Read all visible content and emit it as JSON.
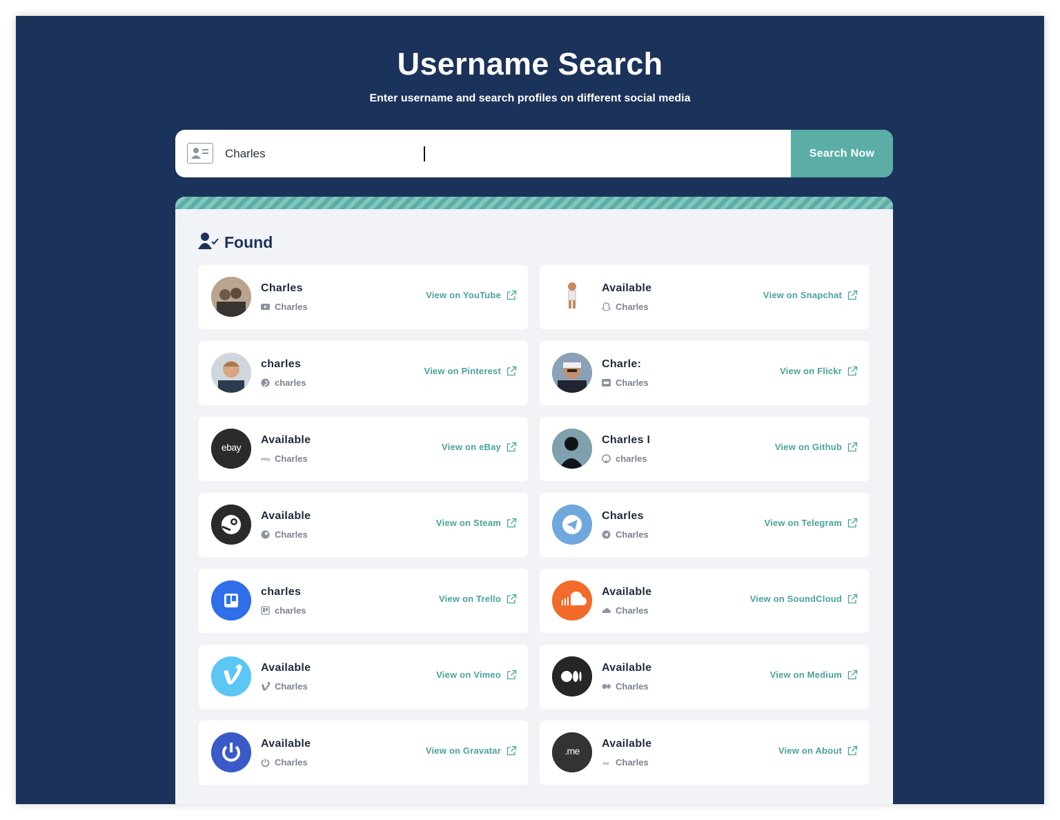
{
  "header": {
    "title": "Username Search",
    "subtitle": "Enter username and search profiles on different social media"
  },
  "search": {
    "value": "Charles",
    "placeholder": "",
    "button_label": "Search Now"
  },
  "results": {
    "heading": "Found",
    "cards": [
      {
        "name": "Charles ",
        "sub": "Charles",
        "link": "View on YouTube",
        "icon": "youtube-icon"
      },
      {
        "name": "Available",
        "sub": "Charles",
        "link": "View on Snapchat",
        "icon": "snapchat-icon"
      },
      {
        "name": "charles",
        "sub": "charles",
        "link": "View on Pinterest",
        "icon": "pinterest-icon"
      },
      {
        "name": "Charle:",
        "sub": "Charles",
        "link": "View on Flickr",
        "icon": "flickr-icon"
      },
      {
        "name": "Available",
        "sub": "Charles",
        "link": "View on eBay",
        "icon": "ebay-icon"
      },
      {
        "name": "Charles I",
        "sub": "charles",
        "link": "View on Github",
        "icon": "github-icon"
      },
      {
        "name": "Available",
        "sub": "Charles",
        "link": "View on Steam",
        "icon": "steam-icon"
      },
      {
        "name": "Charles",
        "sub": "Charles",
        "link": "View on Telegram",
        "icon": "telegram-icon"
      },
      {
        "name": "charles",
        "sub": "charles",
        "link": "View on Trello",
        "icon": "trello-icon"
      },
      {
        "name": "Available",
        "sub": "Charles",
        "link": "View on SoundCloud",
        "icon": "soundcloud-icon"
      },
      {
        "name": "Available",
        "sub": "Charles",
        "link": "View on Vimeo",
        "icon": "vimeo-icon"
      },
      {
        "name": "Available",
        "sub": "Charles",
        "link": "View on Medium",
        "icon": "medium-icon"
      },
      {
        "name": "Available",
        "sub": "Charles",
        "link": "View on Gravatar",
        "icon": "gravatar-icon"
      },
      {
        "name": "Available",
        "sub": "Charles",
        "link": "View on About",
        "icon": "about-me-icon"
      }
    ],
    "logo_text": {
      "ebay": "ebay",
      "about": ".me"
    }
  },
  "colors": {
    "background": "#1b325a",
    "accent": "#5aaea5",
    "link": "#4aa29a",
    "panel": "#f1f3f6"
  }
}
